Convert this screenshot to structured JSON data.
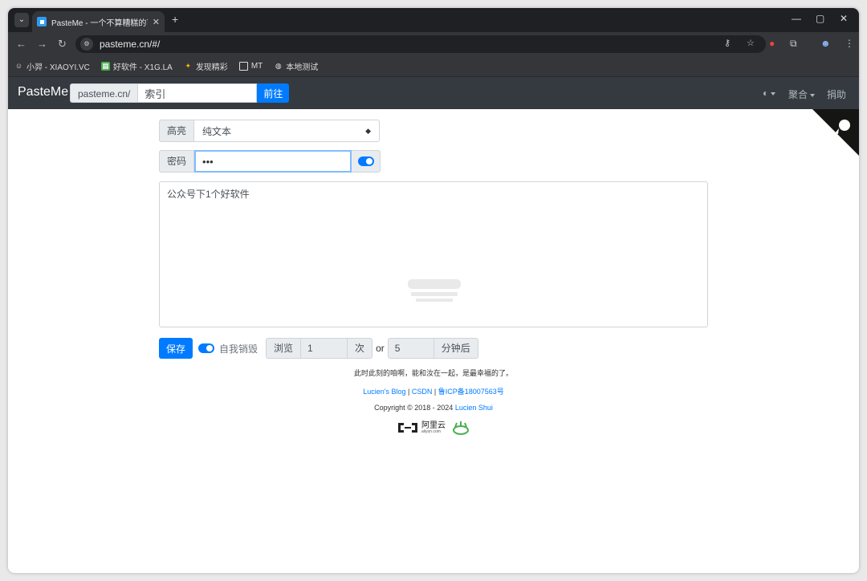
{
  "browser": {
    "tab_title": "PasteMe - 一个不算糟糕的可靠",
    "url": "pasteme.cn/#/",
    "bookmarks": [
      {
        "label": "小羿 - XIAOYI.VC"
      },
      {
        "label": "好软件 - X1G.LA"
      },
      {
        "label": "发现精彩"
      },
      {
        "label": "MT"
      },
      {
        "label": "本地测试"
      }
    ]
  },
  "navbar": {
    "brand": "PasteMe",
    "search_prefix": "pasteme.cn/",
    "search_value": "索引",
    "search_button": "前往",
    "aggregate": "聚合",
    "donate": "捐助"
  },
  "form": {
    "highlight_label": "高亮",
    "highlight_value": "纯文本",
    "password_label": "密码",
    "password_value": "•••",
    "content": "公众号下1个好软件",
    "save_button": "保存",
    "self_destroy_label": "自我销毁",
    "views_label": "浏览",
    "views_value": "1",
    "views_unit": "次",
    "or_text": "or",
    "minutes_value": "5",
    "minutes_unit": "分钟后"
  },
  "footer": {
    "quote": "此时此刻的咱啊，能和汝在一起，是最幸福的了。",
    "blog_link": "Lucien's Blog",
    "csdn_link": "CSDN",
    "icp_link": "鲁ICP备18007563号",
    "sep": "|",
    "copyright_prefix": "Copyright © 2018 - 2024 ",
    "copyright_author": "Lucien Shui",
    "aliyun_text": "阿里云",
    "aliyun_sub": "aliyun.com"
  },
  "colors": {
    "primary": "#007bff",
    "navbar_bg": "#343a40"
  }
}
